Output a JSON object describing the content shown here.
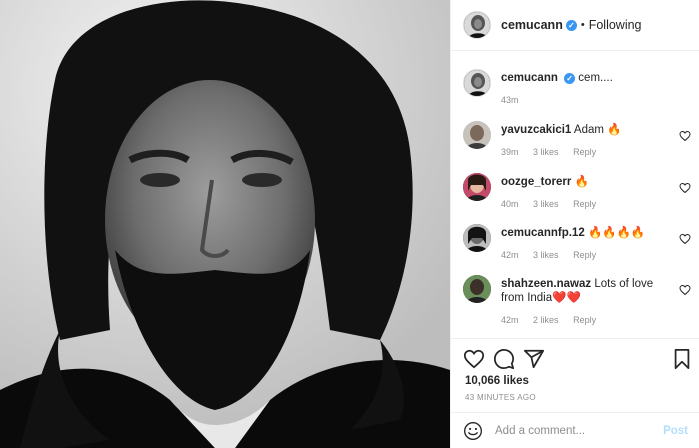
{
  "header": {
    "username": "cemucann",
    "separator": "•",
    "following_label": "Following"
  },
  "caption": {
    "username": "cemucann",
    "text": "cem....",
    "time": "43m"
  },
  "comments": [
    {
      "username": "yavuzcakici1",
      "text": "Adam 🔥",
      "time": "39m",
      "likes": "3 likes",
      "reply": "Reply"
    },
    {
      "username": "oozge_torerr",
      "text": "🔥",
      "time": "40m",
      "likes": "3 likes",
      "reply": "Reply"
    },
    {
      "username": "cemucannfp.12",
      "text": "🔥🔥🔥🔥",
      "time": "42m",
      "likes": "3 likes",
      "reply": "Reply"
    },
    {
      "username": "shahzeen.nawaz",
      "text": "Lots of love from India❤️❤️",
      "time": "42m",
      "likes": "2 likes",
      "reply": "Reply"
    }
  ],
  "post_actions": {
    "likes_count": "10,066 likes",
    "time_ago": "43 MINUTES AGO"
  },
  "add_comment": {
    "placeholder": "Add a comment...",
    "post_label": "Post"
  },
  "icons": [
    "heart-icon",
    "comment-icon",
    "share-icon",
    "bookmark-icon",
    "emoji-icon",
    "verified-badge-icon"
  ],
  "colors": {
    "verified": "#3897f0",
    "muted": "#8e8e8e",
    "post_disabled": "#b2dffc"
  }
}
